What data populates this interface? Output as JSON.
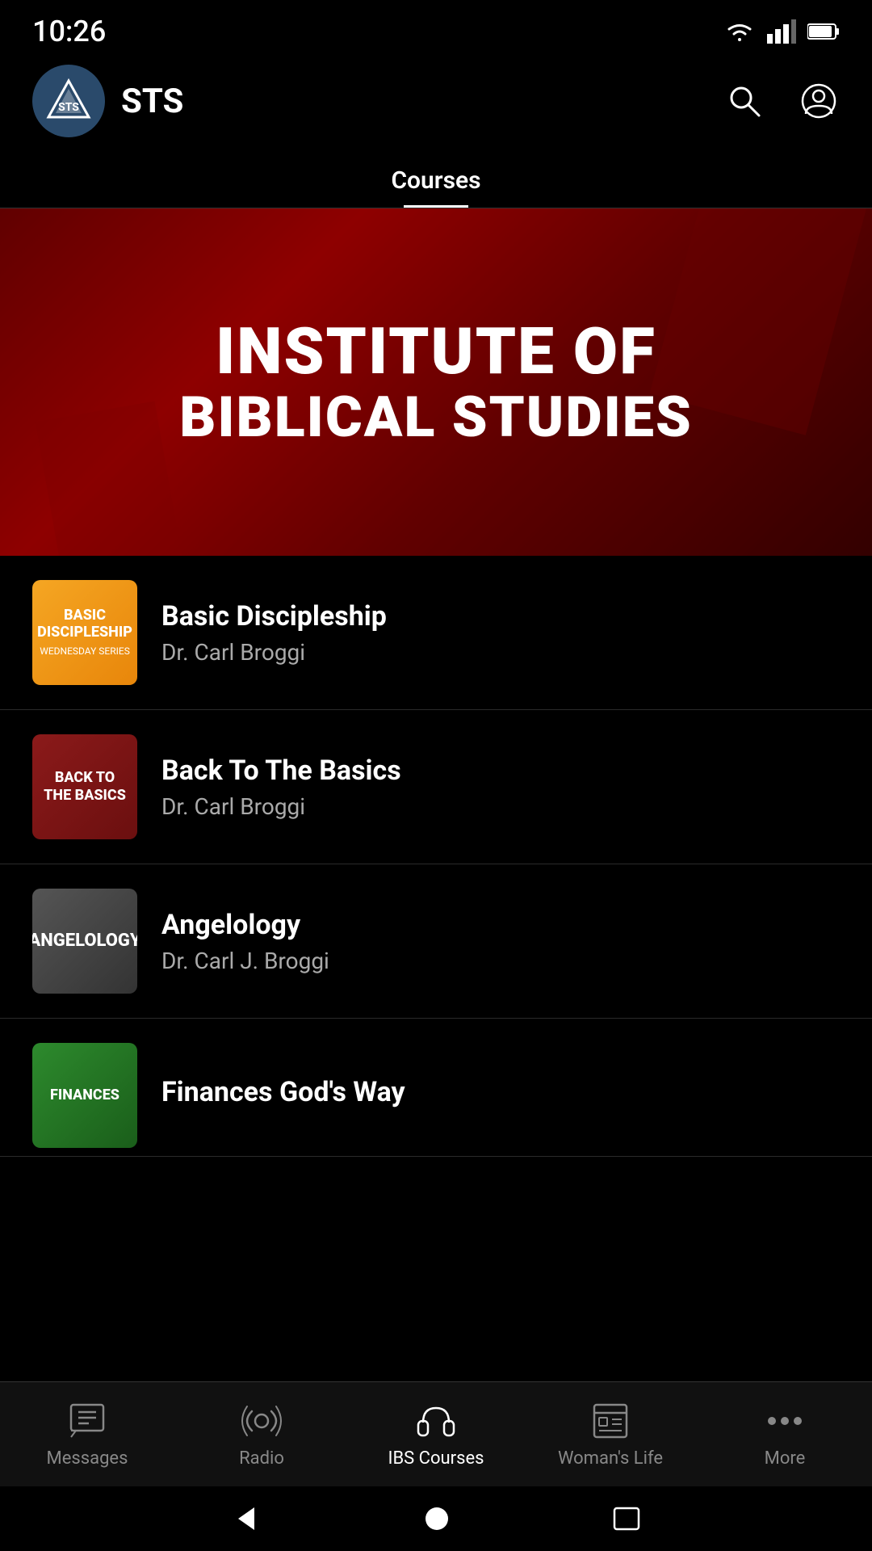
{
  "statusBar": {
    "time": "10:26"
  },
  "header": {
    "brandName": "STS",
    "logoAlt": "STS Logo"
  },
  "topTabs": {
    "activeTab": "Courses",
    "tabs": [
      {
        "label": "Courses"
      }
    ]
  },
  "banner": {
    "line1": "INSTITUTE OF",
    "line2": "BIBLICAL STUDIES"
  },
  "courses": [
    {
      "id": 1,
      "title": "Basic Discipleship",
      "author": "Dr. Carl Broggi",
      "thumbStyle": "basic-discipleship",
      "thumbText": "BASIC DISCIPLESHIP"
    },
    {
      "id": 2,
      "title": "Back To The Basics",
      "author": "Dr. Carl Broggi",
      "thumbStyle": "back-to-basics",
      "thumbText": "BACK TO THE BASICS"
    },
    {
      "id": 3,
      "title": "Angelology",
      "author": "Dr. Carl J. Broggi",
      "thumbStyle": "angelology",
      "thumbText": "Angelology"
    },
    {
      "id": 4,
      "title": "Finances God's Way",
      "author": "",
      "thumbStyle": "finances",
      "thumbText": "FINANCES"
    }
  ],
  "bottomNav": {
    "items": [
      {
        "id": "messages",
        "label": "Messages",
        "icon": "messages-icon"
      },
      {
        "id": "radio",
        "label": "Radio",
        "icon": "radio-icon"
      },
      {
        "id": "ibs-courses",
        "label": "IBS Courses",
        "icon": "headphones-icon",
        "active": true
      },
      {
        "id": "womans-life",
        "label": "Woman's Life",
        "icon": "womans-life-icon"
      },
      {
        "id": "more",
        "label": "More",
        "icon": "more-icon"
      }
    ]
  }
}
